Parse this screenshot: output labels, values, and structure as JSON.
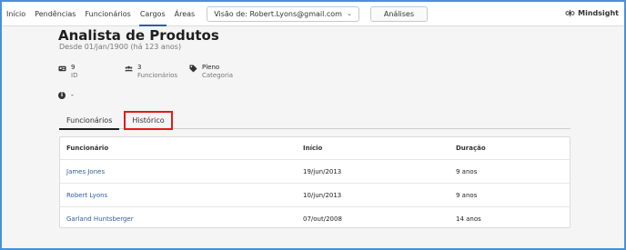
{
  "nav": {
    "items": [
      {
        "label": "Início",
        "active": false
      },
      {
        "label": "Pendências",
        "active": false
      },
      {
        "label": "Funcionários",
        "active": false
      },
      {
        "label": "Cargos",
        "active": true
      },
      {
        "label": "Áreas",
        "active": false
      }
    ],
    "visao_label": "Visão de: Robert.Lyons@gmail.com",
    "analises_label": "Análises",
    "logo_text": "Mindsight"
  },
  "header": {
    "title": "Analista de Produtos",
    "subtitle": "Desde 01/jan/1900 (há 123 anos)"
  },
  "stats": [
    {
      "icon": "id-card-icon",
      "value": "9",
      "label": "ID"
    },
    {
      "icon": "users-icon",
      "value": "3",
      "label": "Funcionários"
    },
    {
      "icon": "tag-icon",
      "value": "Pleno",
      "label": "Categoria"
    }
  ],
  "info": {
    "text": "-"
  },
  "tabs": [
    {
      "label": "Funcionários",
      "active": true
    },
    {
      "label": "Histórico",
      "active": false,
      "highlighted": true
    }
  ],
  "table": {
    "columns": [
      "Funcionário",
      "Início",
      "Duração"
    ],
    "rows": [
      {
        "name": "James Jones",
        "start": "19/jun/2013",
        "duration": "9 anos"
      },
      {
        "name": "Robert Lyons",
        "start": "10/jun/2013",
        "duration": "9 anos"
      },
      {
        "name": "Garland Huntsberger",
        "start": "07/out/2008",
        "duration": "14 anos"
      }
    ]
  },
  "colors": {
    "accent": "#2f5f9e",
    "highlight": "#e21b1b",
    "frame": "#4a90d9"
  }
}
